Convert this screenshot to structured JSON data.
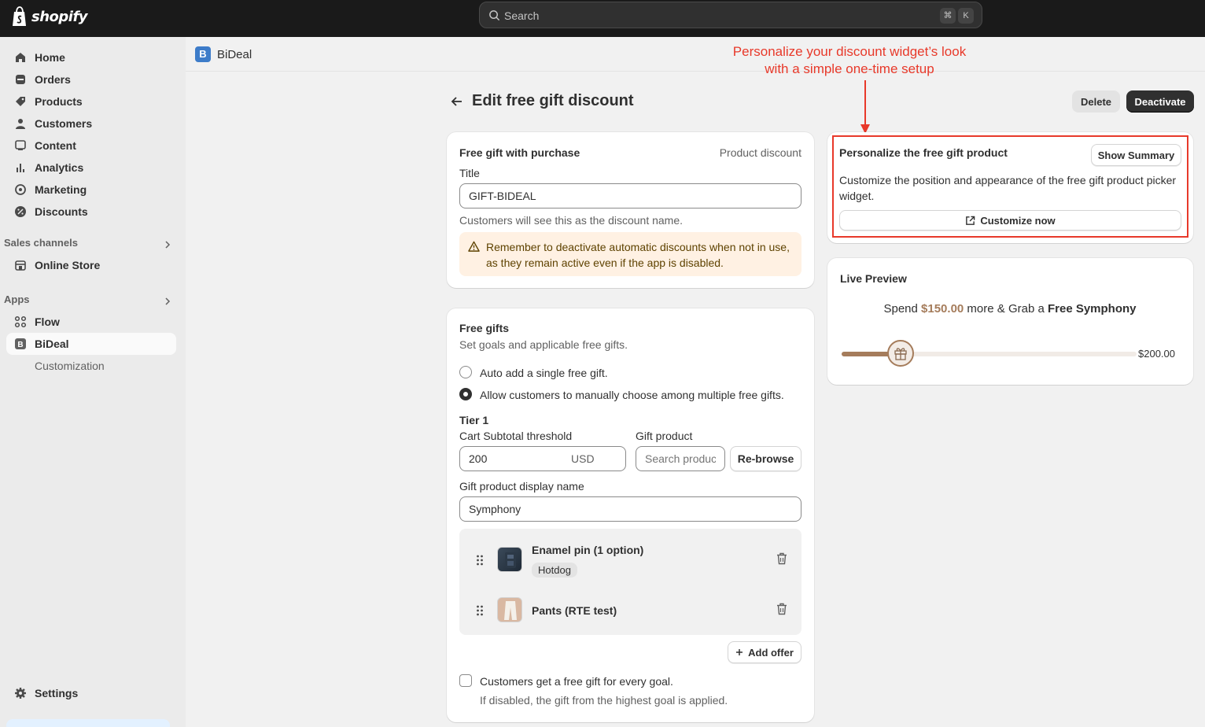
{
  "topbar": {
    "brand": "shopify",
    "search_placeholder": "Search",
    "shortcut_keys": [
      "⌘",
      "K"
    ]
  },
  "sidebar": {
    "items": [
      {
        "label": "Home",
        "icon": "home-icon"
      },
      {
        "label": "Orders",
        "icon": "orders-icon"
      },
      {
        "label": "Products",
        "icon": "tag-icon"
      },
      {
        "label": "Customers",
        "icon": "person-icon"
      },
      {
        "label": "Content",
        "icon": "content-icon"
      },
      {
        "label": "Analytics",
        "icon": "bar-chart-icon"
      },
      {
        "label": "Marketing",
        "icon": "target-icon"
      },
      {
        "label": "Discounts",
        "icon": "discount-icon"
      }
    ],
    "sales_channels_label": "Sales channels",
    "online_store_label": "Online Store",
    "apps_label": "Apps",
    "flow_label": "Flow",
    "bideal_label": "BiDeal",
    "customization_label": "Customization",
    "settings_label": "Settings"
  },
  "appbar": {
    "app_icon_letter": "B",
    "app_name": "BiDeal"
  },
  "annotation": {
    "line1": "Personalize your discount widget’s look",
    "line2": "with a simple one-time setup",
    "color": "#e8392a"
  },
  "page": {
    "title": "Edit free gift discount",
    "delete_label": "Delete",
    "deactivate_label": "Deactivate"
  },
  "discount_card": {
    "heading": "Free gift with purchase",
    "type": "Product discount",
    "title_label": "Title",
    "title_value": "GIFT-BIDEAL",
    "help": "Customers will see this as the discount name.",
    "warning": "Remember to deactivate automatic discounts when not in use, as they remain active even if the app is disabled."
  },
  "gifts_card": {
    "heading": "Free gifts",
    "subheading": "Set goals and applicable free gifts.",
    "option_auto": "Auto add a single free gift.",
    "option_manual": "Allow customers to manually choose among multiple free gifts.",
    "tier_label": "Tier 1",
    "threshold_label": "Cart Subtotal threshold",
    "threshold_value": "200",
    "threshold_currency": "USD",
    "gift_product_label": "Gift product",
    "gift_product_placeholder": "Search product",
    "rebrowse_label": "Re-browse",
    "display_name_label": "Gift product display name",
    "display_name_value": "Symphony",
    "gifts": [
      {
        "name": "Enamel pin (1 option)",
        "variant": "Hotdog"
      },
      {
        "name": "Pants (RTE test)",
        "variant": ""
      }
    ],
    "add_offer_label": "Add offer",
    "every_goal_label": "Customers get a free gift for every goal.",
    "every_goal_help": "If disabled, the gift from the highest goal is applied."
  },
  "personalize_card": {
    "heading": "Personalize the free gift product",
    "show_summary_label": "Show Summary",
    "description": "Customize the position and appearance of the free gift product picker widget.",
    "customize_label": "Customize now"
  },
  "preview_card": {
    "heading": "Live Preview",
    "text_prefix": "Spend ",
    "amount": "$150.00",
    "text_middle": " more & Grab a ",
    "gift_name": "Free Symphony",
    "goal_label": "$200.00",
    "progress_fraction": 0.2,
    "accent_color": "#a57c5b"
  }
}
